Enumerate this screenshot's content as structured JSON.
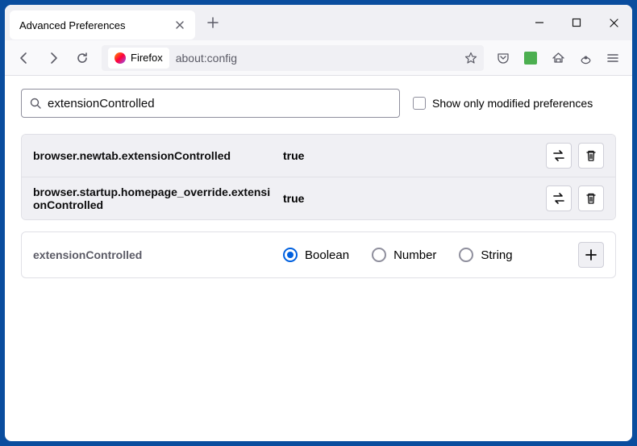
{
  "window": {
    "tab_title": "Advanced Preferences"
  },
  "toolbar": {
    "firefox_label": "Firefox",
    "url": "about:config"
  },
  "search": {
    "value": "extensionControlled",
    "show_only_modified": "Show only modified preferences"
  },
  "prefs": [
    {
      "name": "browser.newtab.extensionControlled",
      "value": "true"
    },
    {
      "name": "browser.startup.homepage_override.extensionControlled",
      "value": "true"
    }
  ],
  "new_pref": {
    "name": "extensionControlled",
    "types": {
      "boolean": "Boolean",
      "number": "Number",
      "string": "String"
    }
  }
}
